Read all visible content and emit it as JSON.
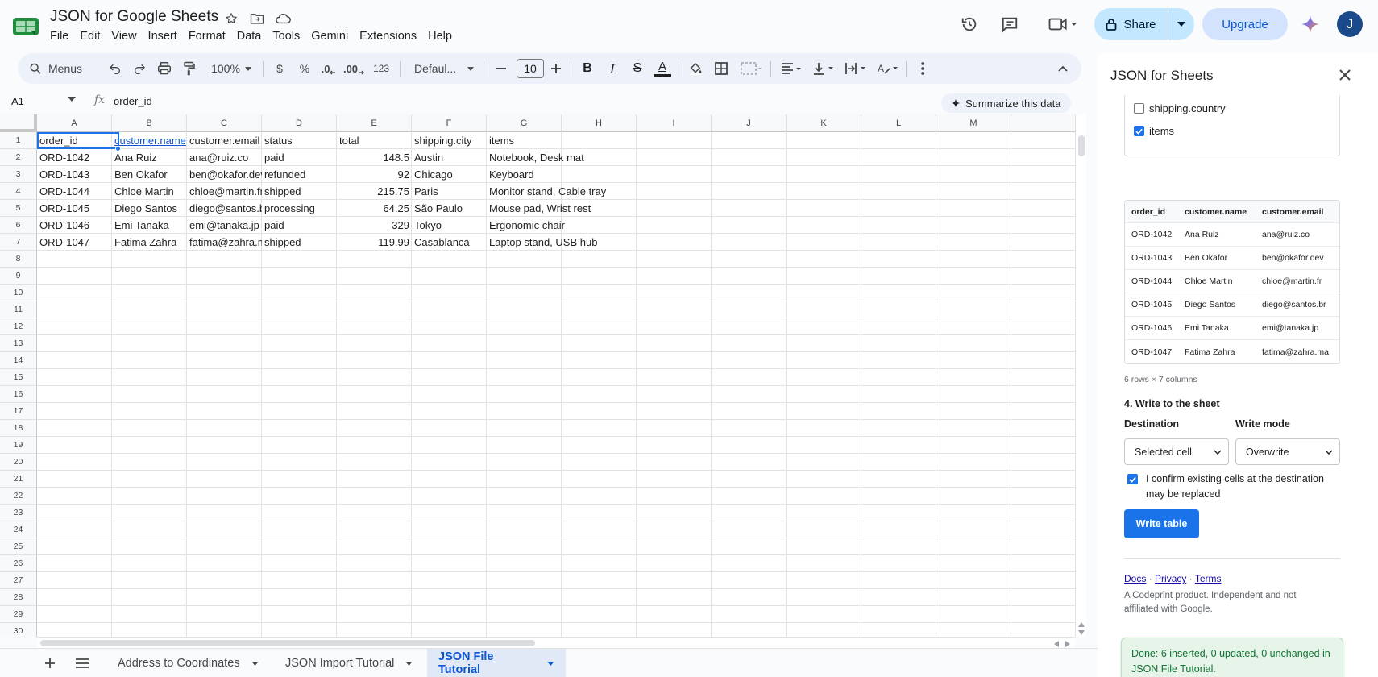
{
  "app": {
    "doc_title": "JSON for Google Sheets",
    "menu": [
      "File",
      "Edit",
      "View",
      "Insert",
      "Format",
      "Data",
      "Tools",
      "Gemini",
      "Extensions",
      "Help"
    ],
    "share_label": "Share",
    "upgrade_label": "Upgrade",
    "avatar_initial": "J",
    "accent_color": "#0b57d0",
    "brand_color": "#0f9d58"
  },
  "toolbar": {
    "menus_label": "Menus",
    "zoom": "100%",
    "currency": "$",
    "percent": "%",
    "decrease_decimal": ".0",
    "increase_decimal": ".00",
    "number_format": "123",
    "font": "Defaul...",
    "font_size": "10",
    "bold": "B",
    "italic": "I",
    "strike": "S",
    "text_color": "A"
  },
  "formula": {
    "cell_ref": "A1",
    "fx": "fx",
    "value": "order_id",
    "summarize_label": "Summarize this data"
  },
  "grid": {
    "columns": [
      "A",
      "B",
      "C",
      "D",
      "E",
      "F",
      "G",
      "H",
      "I",
      "J",
      "K",
      "L",
      "M"
    ],
    "rows": [
      "1",
      "2",
      "3",
      "4",
      "5",
      "6",
      "7",
      "8",
      "9",
      "10",
      "11",
      "12",
      "13",
      "14",
      "15",
      "16",
      "17",
      "18",
      "19",
      "20",
      "21",
      "22",
      "23",
      "24",
      "25",
      "26",
      "27",
      "28",
      "29",
      "30"
    ],
    "data": [
      [
        "order_id",
        "customer.name",
        "customer.email",
        "status",
        "total",
        "shipping.city",
        "items"
      ],
      [
        "ORD-1042",
        "Ana Ruiz",
        "ana@ruiz.co",
        "paid",
        "148.5",
        "Austin",
        "Notebook, Desk mat"
      ],
      [
        "ORD-1043",
        "Ben Okafor",
        "ben@okafor.dev",
        "refunded",
        "92",
        "Chicago",
        "Keyboard"
      ],
      [
        "ORD-1044",
        "Chloe Martin",
        "chloe@martin.fr",
        "shipped",
        "215.75",
        "Paris",
        "Monitor stand, Cable tray"
      ],
      [
        "ORD-1045",
        "Diego Santos",
        "diego@santos.b",
        "processing",
        "64.25",
        "São Paulo",
        "Mouse pad, Wrist rest"
      ],
      [
        "ORD-1046",
        "Emi Tanaka",
        "emi@tanaka.jp",
        "paid",
        "329",
        "Tokyo",
        "Ergonomic chair"
      ],
      [
        "ORD-1047",
        "Fatima Zahra",
        "fatima@zahra.m",
        "shipped",
        "119.99",
        "Casablanca",
        "Laptop stand, USB hub"
      ]
    ]
  },
  "sheet_tabs": [
    {
      "label": "Address to Coordinates",
      "active": false
    },
    {
      "label": "JSON Import Tutorial",
      "active": false
    },
    {
      "label": "JSON File Tutorial",
      "active": true
    }
  ],
  "sidebar": {
    "title": "JSON for Sheets",
    "fields": [
      {
        "label": "shipping.country",
        "checked": false
      },
      {
        "label": "items",
        "checked": true
      }
    ],
    "preview_headers": [
      "order_id",
      "customer.name",
      "customer.email"
    ],
    "preview_rows": [
      [
        "ORD-1042",
        "Ana Ruiz",
        "ana@ruiz.co"
      ],
      [
        "ORD-1043",
        "Ben Okafor",
        "ben@okafor.dev"
      ],
      [
        "ORD-1044",
        "Chloe Martin",
        "chloe@martin.fr"
      ],
      [
        "ORD-1045",
        "Diego Santos",
        "diego@santos.br"
      ],
      [
        "ORD-1046",
        "Emi Tanaka",
        "emi@tanaka.jp"
      ],
      [
        "ORD-1047",
        "Fatima Zahra",
        "fatima@zahra.ma"
      ]
    ],
    "rows_meta": "6 rows × 7 columns",
    "section_write": "4. Write to the sheet",
    "destination_label": "Destination",
    "destination_value": "Selected cell",
    "write_mode_label": "Write mode",
    "write_mode_value": "Overwrite",
    "confirm_text": "I confirm existing cells at the destination may be replaced",
    "confirm_checked": true,
    "write_button": "Write table",
    "link_docs": "Docs",
    "link_privacy": "Privacy",
    "link_terms": "Terms",
    "link_sep": "·",
    "product_note": "A Codeprint product. Independent and not affiliated with Google.",
    "status_text": "Done: 6 inserted, 0 updated, 0 unchanged in JSON File Tutorial."
  }
}
